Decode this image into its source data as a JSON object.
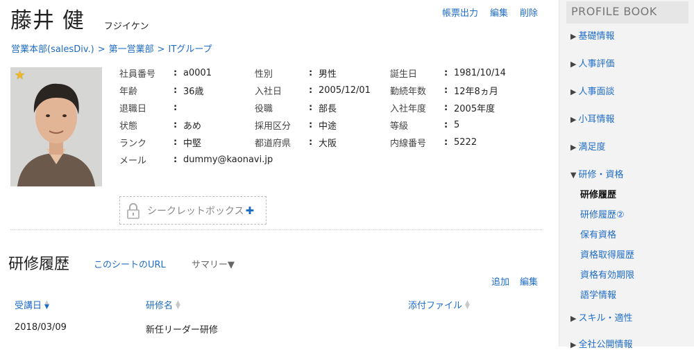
{
  "profile": {
    "name": "藤井 健",
    "kana": "フジイケン"
  },
  "top_actions": [
    "帳票出力",
    "編集",
    "削除"
  ],
  "breadcrumb": [
    "営業本部(salesDiv.)",
    "第一営業部",
    "ITグループ"
  ],
  "fields": [
    [
      {
        "label": "社員番号",
        "value": "a0001"
      },
      {
        "label": "性別",
        "value": "男性"
      },
      {
        "label": "誕生日",
        "value": "1981/10/14"
      }
    ],
    [
      {
        "label": "年齢",
        "value": "36歳"
      },
      {
        "label": "入社日",
        "value": "2005/12/01"
      },
      {
        "label": "勤続年数",
        "value": "12年8ヵ月"
      }
    ],
    [
      {
        "label": "退職日",
        "value": ""
      },
      {
        "label": "役職",
        "value": "部長"
      },
      {
        "label": "入社年度",
        "value": "2005年度"
      }
    ],
    [
      {
        "label": "状態",
        "value": "あめ"
      },
      {
        "label": "採用区分",
        "value": "中途"
      },
      {
        "label": "等級",
        "value": "5"
      }
    ],
    [
      {
        "label": "ランク",
        "value": "中堅"
      },
      {
        "label": "都道府県",
        "value": "大阪"
      },
      {
        "label": "内線番号",
        "value": "5222"
      }
    ]
  ],
  "mail": {
    "label": "メール",
    "value": "dummy@kaonavi.jp"
  },
  "secret_box": {
    "label": "シークレットボックス",
    "plus": "✚"
  },
  "section": {
    "title": "研修履歴",
    "sheet_link": "このシートのURL",
    "summary": "サマリー▼"
  },
  "table_actions": [
    "追加",
    "編集"
  ],
  "table": {
    "headers": [
      "受講日",
      "研修名",
      "添付ファイル"
    ],
    "rows": [
      [
        "2018/03/09",
        "新任リーダー研修",
        ""
      ]
    ]
  },
  "sidebar": {
    "title": "PROFILE BOOK",
    "items": [
      {
        "label": "基礎情報",
        "tri": "▶"
      },
      {
        "label": "人事評価",
        "tri": "▶"
      },
      {
        "label": "人事面談",
        "tri": "▶"
      },
      {
        "label": "小耳情報",
        "tri": "▶"
      },
      {
        "label": "満足度",
        "tri": "▶"
      },
      {
        "label": "研修・資格",
        "tri": "▼"
      }
    ],
    "sub_items": [
      "研修履歴",
      "研修履歴②",
      "保有資格",
      "資格取得履歴",
      "資格有効期限",
      "語学情報"
    ],
    "after_items": [
      {
        "label": "スキル・適性",
        "tri": "▶"
      },
      {
        "label": "全社公開情報",
        "tri": "▶"
      }
    ]
  },
  "icons": {
    "favorite": "star-icon",
    "secret": "lock-icon",
    "sort": "sort-icon"
  },
  "colors": {
    "link": "#1f6cc6",
    "star": "#f2b821",
    "sidebar_bg": "#f3f3f3"
  }
}
